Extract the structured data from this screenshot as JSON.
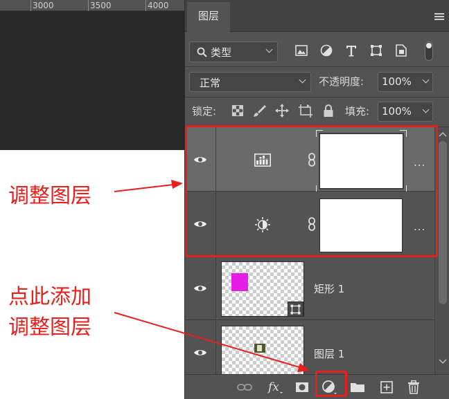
{
  "ruler": {
    "labels": [
      "3000",
      "3500",
      "4000"
    ]
  },
  "annotations": {
    "adjustment_layers": "调整图层",
    "click_add_line1": "点此添加",
    "click_add_line2": "调整图层"
  },
  "panel": {
    "tab_label": "图层",
    "filter": {
      "label": "类型",
      "icons": [
        "image-filter-icon",
        "adjustment-filter-icon",
        "type-filter-icon",
        "shape-filter-icon",
        "smart-object-filter-icon"
      ]
    },
    "blend_mode": "正常",
    "opacity_label": "不透明度:",
    "opacity_value": "100%",
    "lock_label": "锁定:",
    "fill_label": "填充:",
    "fill_value": "100%",
    "layers": [
      {
        "type": "adjustment",
        "icon": "levels-adjustment-icon",
        "selected": true,
        "more": "..."
      },
      {
        "type": "adjustment",
        "icon": "brightness-adjustment-icon",
        "selected": false,
        "more": "..."
      },
      {
        "type": "shape",
        "name": "矩形 1",
        "swatch_color": "#e61de6"
      },
      {
        "type": "pixel",
        "name": "图层 1"
      }
    ]
  },
  "colors": {
    "annotation": "#e8201c",
    "panel_bg": "#535353",
    "selected_row": "#6a6a6a"
  }
}
